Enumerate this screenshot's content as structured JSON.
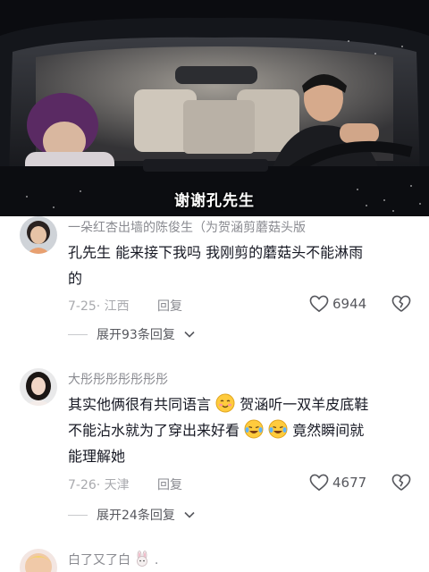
{
  "video": {
    "subtitle": "谢谢孔先生"
  },
  "comments": [
    {
      "username": "一朵红杏出墙的陈俊生（为贺涵剪蘑菇头版",
      "text_line1": "孔先生 能来接下我吗 我刚剪的蘑菇头不能淋雨",
      "text_line2": "的",
      "date_loc": "7-25· 江西",
      "reply_label": "回复",
      "likes": "6944",
      "expand_label": "展开93条回复"
    },
    {
      "username": "大彤彤彤彤彤彤彤",
      "text_line1a": "其实他俩很有共同语言",
      "text_line1b": "贺涵听一双羊皮底鞋",
      "text_line2a": "不能沾水就为了穿出来好看",
      "text_line2b": "竟然瞬间就",
      "text_line3": "能理解她",
      "date_loc": "7-26· 天津",
      "reply_label": "回复",
      "likes": "4677",
      "expand_label": "展开24条回复"
    },
    {
      "username": "白了又了白",
      "suffix": "."
    }
  ],
  "icons": {
    "like": "heart-outline-icon",
    "dislike": "broken-heart-icon",
    "expand": "chevron-down-icon",
    "emoji_blush": "blushing-smile-emoji",
    "emoji_cry_laugh": "tears-of-joy-emoji",
    "emoji_rabbit": "rabbit-face-emoji"
  },
  "colors": {
    "username": "#8a8b91",
    "text": "#161823",
    "meta": "#a9aaae"
  }
}
